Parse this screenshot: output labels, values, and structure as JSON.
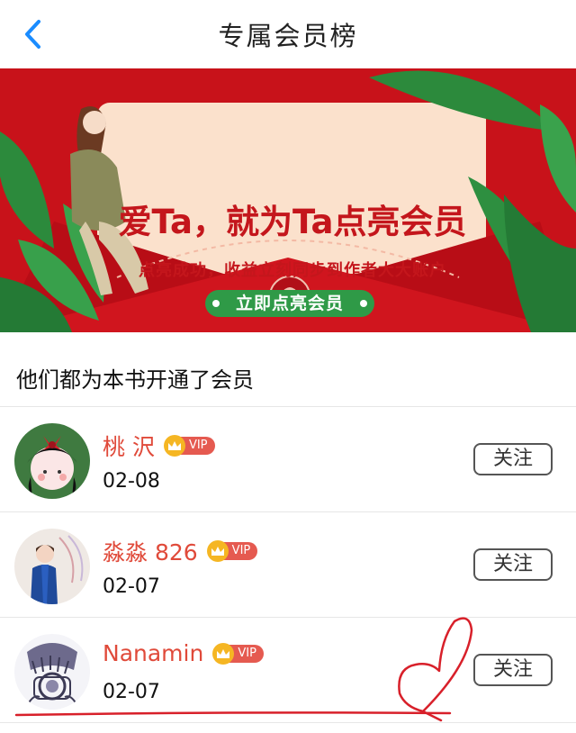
{
  "header": {
    "title": "专属会员榜",
    "back_icon": "chevron-left-icon"
  },
  "banner": {
    "headline": "爱Ta，就为Ta点亮会员",
    "subtitle": "点亮成功，收益立刻同步到作者大大账户",
    "button_label": "立即点亮会员"
  },
  "section_title": "他们都为本书开通了会员",
  "members": [
    {
      "name": "桃 沢",
      "date": "02-08",
      "badge": "VIP",
      "follow_label": "关注"
    },
    {
      "name": "淼淼 826",
      "date": "02-07",
      "badge": "VIP",
      "follow_label": "关注"
    },
    {
      "name": "Nanamin",
      "date": "02-07",
      "badge": "VIP",
      "follow_label": "关注"
    }
  ],
  "colors": {
    "accent_red": "#c8121a",
    "name_red": "#e04a3a",
    "vip_tag": "#e55a50",
    "crown": "#f5b623",
    "back_blue": "#1a8cff"
  }
}
